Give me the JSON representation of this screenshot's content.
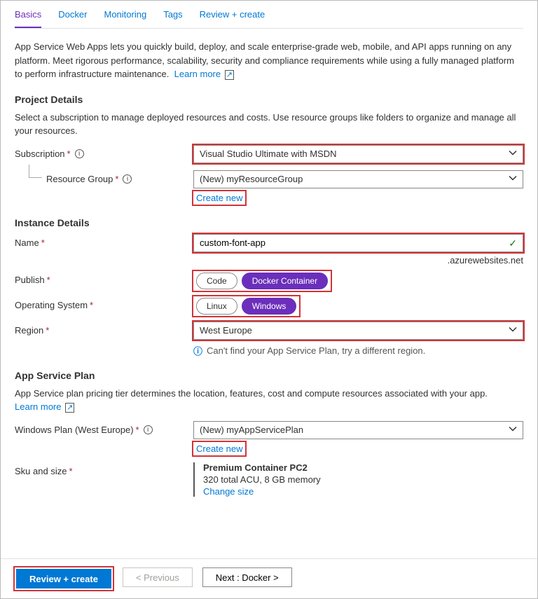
{
  "tabs": {
    "basics": "Basics",
    "docker": "Docker",
    "monitoring": "Monitoring",
    "tags": "Tags",
    "review": "Review + create"
  },
  "intro": {
    "text": "App Service Web Apps lets you quickly build, deploy, and scale enterprise-grade web, mobile, and API apps running on any platform. Meet rigorous performance, scalability, security and compliance requirements while using a fully managed platform to perform infrastructure maintenance.",
    "learn": "Learn more"
  },
  "sections": {
    "project": {
      "title": "Project Details",
      "desc": "Select a subscription to manage deployed resources and costs. Use resource groups like folders to organize and manage all your resources.",
      "subscription_label": "Subscription",
      "subscription_value": "Visual Studio Ultimate with MSDN",
      "rg_label": "Resource Group",
      "rg_value": "(New) myResourceGroup",
      "create_new": "Create new"
    },
    "instance": {
      "title": "Instance Details",
      "name_label": "Name",
      "name_value": "custom-font-app",
      "name_suffix": ".azurewebsites.net",
      "publish_label": "Publish",
      "publish_code": "Code",
      "publish_docker": "Docker Container",
      "os_label": "Operating System",
      "os_linux": "Linux",
      "os_windows": "Windows",
      "region_label": "Region",
      "region_value": "West Europe",
      "region_hint": "Can't find your App Service Plan, try a different region."
    },
    "plan": {
      "title": "App Service Plan",
      "desc": "App Service plan pricing tier determines the location, features, cost and compute resources associated with your app.",
      "learn": "Learn more",
      "plan_label": "Windows Plan (West Europe)",
      "plan_value": "(New) myAppServicePlan",
      "create_new": "Create new",
      "sku_label": "Sku and size",
      "sku_title": "Premium Container PC2",
      "sku_detail": "320 total ACU, 8 GB memory",
      "change": "Change size"
    }
  },
  "footer": {
    "review": "Review + create",
    "previous": "< Previous",
    "next": "Next : Docker"
  }
}
